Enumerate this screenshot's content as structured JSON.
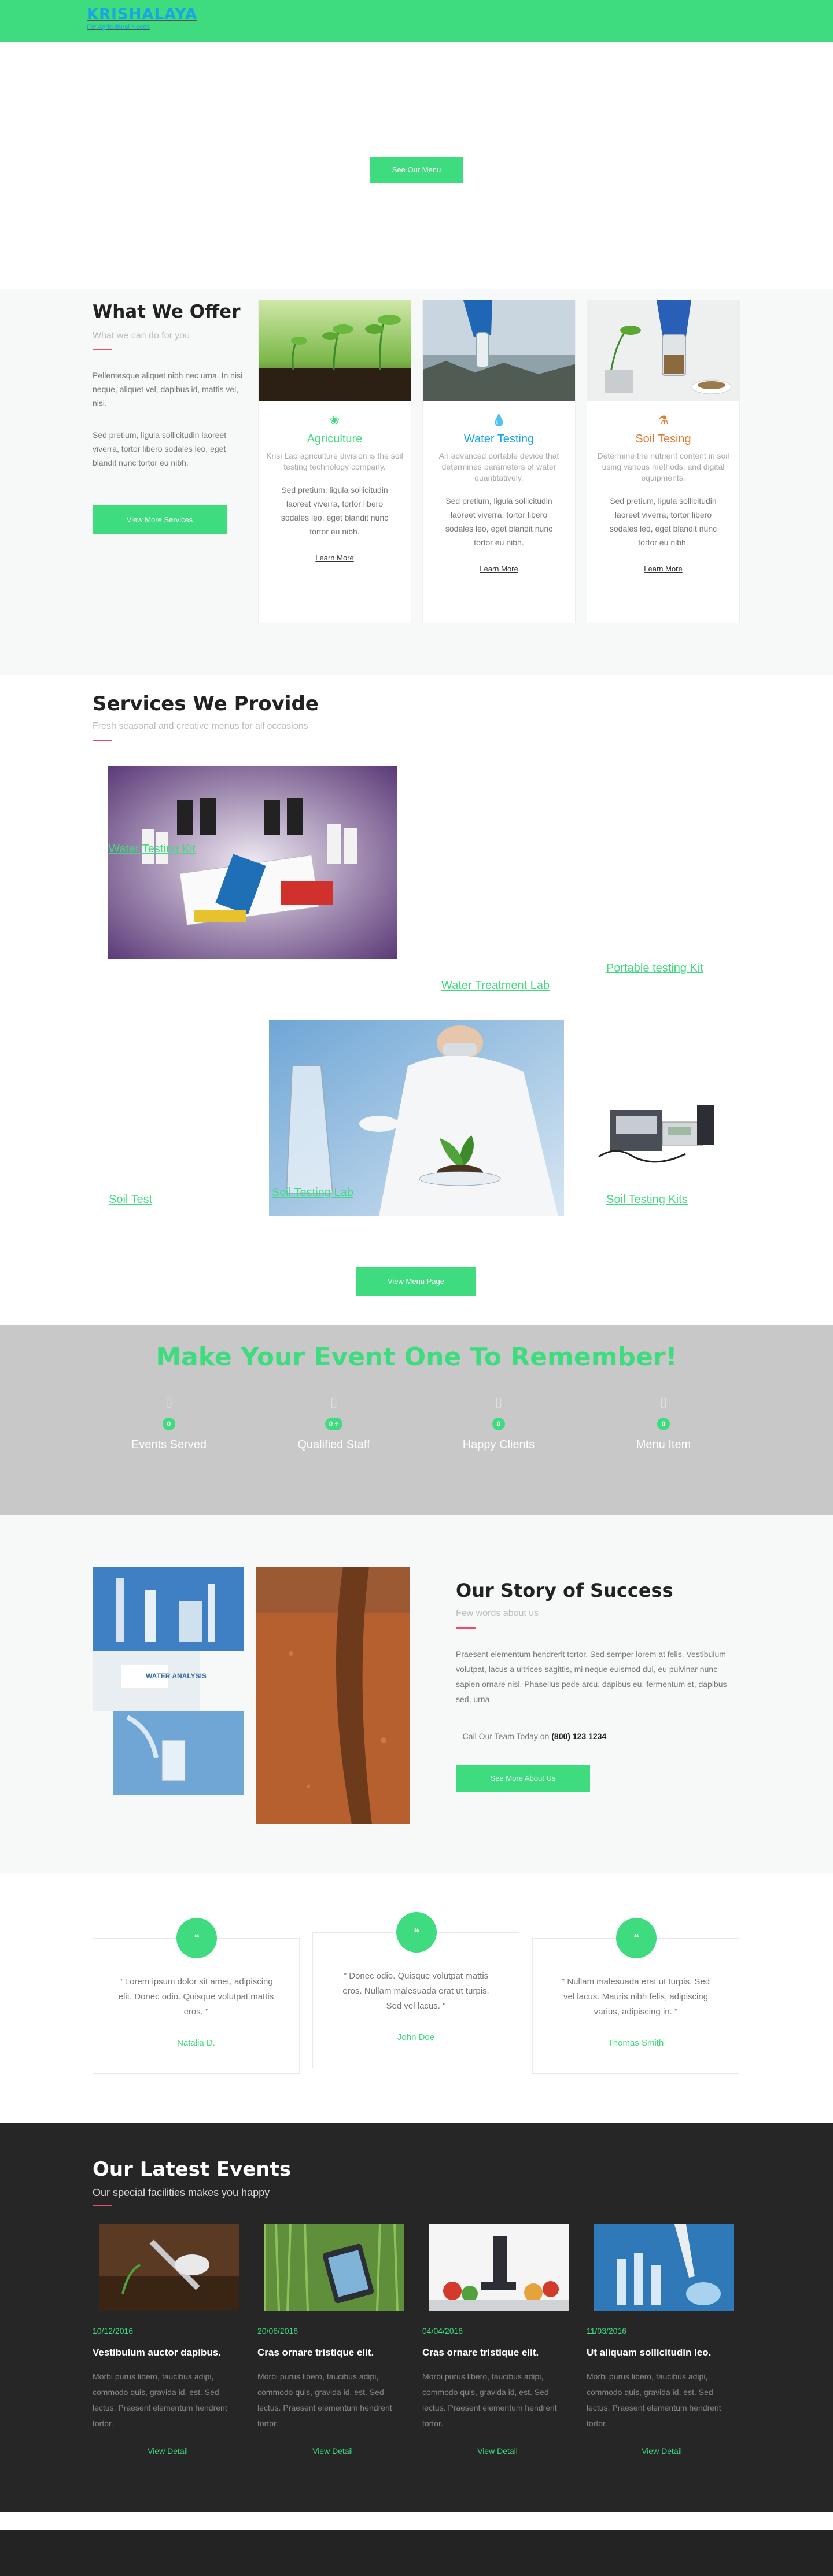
{
  "header": {
    "logo_title": "KRISHALAYA",
    "logo_tagline": "For Agricultural Needs",
    "colors": {
      "bar": "#3edb7f",
      "logo": "#1aa3e8"
    }
  },
  "hero": {
    "button_label": "See Our Menu"
  },
  "offer": {
    "title": "What We Offer",
    "subtitle": "What we can do for you",
    "paragraph1": "Pellentesque aliquet nibh nec urna. In nisi neque, aliquet vel, dapibus id, mattis vel, nisi.",
    "paragraph2": "Sed pretium, ligula sollicitudin laoreet viverra, tortor libero sodales leo, eget blandit nunc tortor eu nibh.",
    "button_label": "View More Services",
    "cards": [
      {
        "icon": "leaf-icon",
        "title": "Agriculture",
        "title_color": "#3edb7f",
        "desc": "Krisi Lab agriculture division is the soil testing technology company.",
        "body": "Sed pretium, ligula sollicitudin laoreet viverra, tortor libero sodales leo, eget blandit nunc tortor eu nibh.",
        "link": "Learn More"
      },
      {
        "icon": "droplet-icon",
        "title": "Water Testing",
        "title_color": "#1aa3e8",
        "desc": "An advanced portable device that determines parameters of water quantitatively.",
        "body": "Sed pretium, ligula sollicitudin laoreet viverra, tortor libero sodales leo, eget blandit nunc tortor eu nibh.",
        "link": "Learn More"
      },
      {
        "icon": "flask-icon",
        "title": "Soil Tesing",
        "title_color": "#e07a2e",
        "desc": "Determine the nutrient content in soil using various methods, and digital equipments.",
        "body": "Sed pretium, ligula sollicitudin laoreet viverra, tortor libero sodales leo, eget blandit nunc tortor eu nibh.",
        "link": "Learn More"
      }
    ]
  },
  "services": {
    "title": "Services We Provide",
    "subtitle": "Fresh seasonal and creative menus for all occasions",
    "items": [
      "Water Testing Kit",
      "Water Treatment Lab",
      "Portable testing Kit",
      "Soil Test",
      "Soil Testing Lab",
      "Soil Testing Kits"
    ],
    "button_label": "View Menu Page"
  },
  "stats": {
    "title": "Make Your Event One To Remember!",
    "items": [
      {
        "icon": "calendar-icon",
        "value": "0",
        "label": "Events Served"
      },
      {
        "icon": "users-icon",
        "value": "0 +",
        "label": "Qualified Staff"
      },
      {
        "icon": "smile-icon",
        "value": "0",
        "label": "Happy Clients"
      },
      {
        "icon": "menu-icon",
        "value": "0",
        "label": "Menu Item"
      }
    ]
  },
  "story": {
    "title": "Our Story of Success",
    "subtitle": "Few words about us",
    "text": "Praesent elementum hendrerit tortor. Sed semper lorem at felis. Vestibulum volutpat, lacus a ultrices sagittis, mi neque euismod dui, eu pulvinar nunc sapien ornare nisl. Phasellus pede arcu, dapibus eu, fermentum et, dapibus sed, urna.",
    "call_prefix": "– Call Our Team Today on",
    "phone": "(800) 123 1234",
    "button_label": "See More About Us",
    "image_label": "WATER ANALYSIS"
  },
  "testimonials": [
    {
      "icon": "quote-icon",
      "quote": "\" Lorem ipsum dolor sit amet, adipiscing elit. Donec odio. Quisque volutpat mattis eros. \"",
      "name": "Natalia D."
    },
    {
      "icon": "quote-icon",
      "quote": "\" Donec odio. Quisque volutpat mattis eros. Nullam malesuada erat ut turpis. Sed vel lacus. \"",
      "name": "John Doe"
    },
    {
      "icon": "quote-icon",
      "quote": "\" Nullam malesuada erat ut turpis. Sed vel lacus. Mauris nibh felis, adipiscing varius, adipiscing in. \"",
      "name": "Thomas Smith"
    }
  ],
  "events": {
    "title": "Our Latest Events",
    "subtitle": "Our special facilities makes you happy",
    "items": [
      {
        "date": "10/12/2016",
        "title": "Vestibulum auctor dapibus.",
        "text": "Morbi purus libero, faucibus adipi, commodo quis, gravida id, est. Sed lectus. Praesent elementum hendrerit tortor.",
        "link": "View Detail"
      },
      {
        "date": "20/06/2016",
        "title": "Cras ornare tristique elit.",
        "text": "Morbi purus libero, faucibus adipi, commodo quis, gravida id, est. Sed lectus. Praesent elementum hendrerit tortor.",
        "link": "View Detail"
      },
      {
        "date": "04/04/2016",
        "title": "Cras ornare tristique elit.",
        "text": "Morbi purus libero, faucibus adipi, commodo quis, gravida id, est. Sed lectus. Praesent elementum hendrerit tortor.",
        "link": "View Detail"
      },
      {
        "date": "11/03/2016",
        "title": "Ut aliquam sollicitudin leo.",
        "text": "Morbi purus libero, faucibus adipi, commodo quis, gravida id, est. Sed lectus. Praesent elementum hendrerit tortor.",
        "link": "View Detail"
      }
    ]
  }
}
